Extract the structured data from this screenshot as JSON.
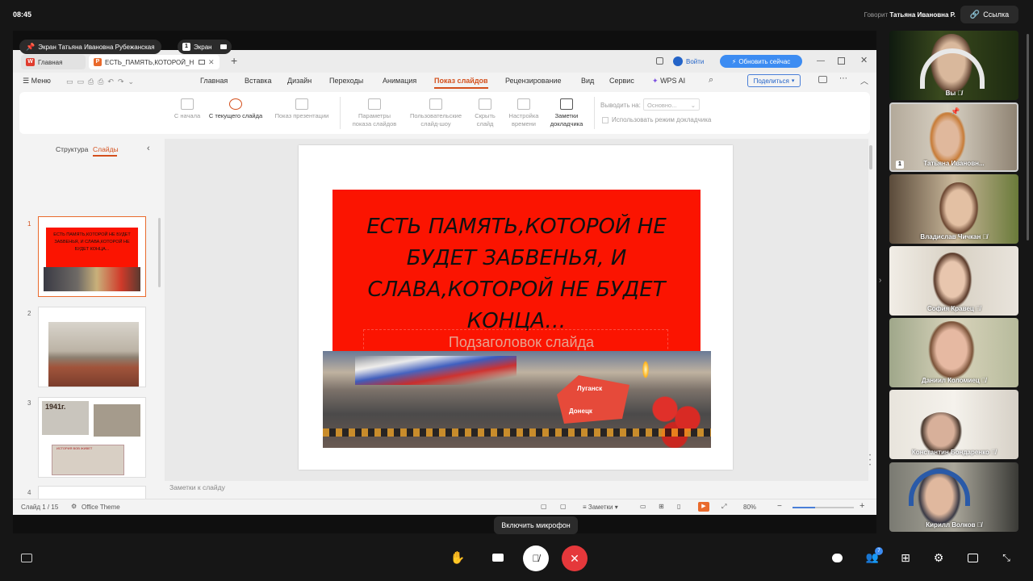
{
  "topbar": {
    "time": "08:45",
    "speaker_prefix": "Говорит",
    "speaker_name": "Татьяна Ивановна Р.",
    "link_label": "Ссылка"
  },
  "share": {
    "label": "Экран Татьяна Ивановна Рубежанская",
    "screen_pill": "Экран",
    "screen_badge": "1"
  },
  "wps": {
    "tab_home": "Главная",
    "tab_doc": "ЕСТЬ_ПАМЯТЬ,КОТОРОЙ_НЕ",
    "login": "Войти",
    "update": "Обновить сейчас",
    "menu_label": "Меню",
    "menus": [
      "Главная",
      "Вставка",
      "Дизайн",
      "Переходы",
      "Анимация",
      "Показ слайдов",
      "Рецензирование",
      "Вид",
      "Сервис",
      "WPS AI"
    ],
    "share_btn": "Поделиться",
    "ribbon": {
      "from_start": "С начала",
      "from_current": "С текущего слайда",
      "show_presentation": "Показ презентации",
      "params_1": "Параметры",
      "params_2": "показа слайдов",
      "custom_1": "Пользовательские",
      "custom_2": "слайд-шоу",
      "hide_1": "Скрыть",
      "hide_2": "слайд",
      "timing_1": "Настройка",
      "timing_2": "времени",
      "notes_1": "Заметки",
      "notes_2": "докладчика",
      "output_label": "Выводить на:",
      "output_value": "Основно...",
      "presenter_mode": "Использовать режим докладчика"
    },
    "panel": {
      "tab_structure": "Структура",
      "tab_slides": "Слайды"
    },
    "thumb_title": "ЕСТЬ ПАМЯТЬ,КОТОРОЙ НЕ БУДЕТ ЗАБВЕНЬЯ, И СЛАВА,КОТОРОЙ НЕ БУДЕТ КОНЦА...",
    "thumb_1941": "1941г.",
    "thumb_caption": "ИСТОРИЯ ВОВ ЖИВЕТ",
    "slide_numbers": [
      "1",
      "2",
      "3",
      "4"
    ],
    "slide": {
      "title": "ЕСТЬ ПАМЯТЬ,КОТОРОЙ НЕ БУДЕТ ЗАБВЕНЬЯ, И СЛАВА,КОТОРОЙ НЕ БУДЕТ КОНЦА…",
      "subtitle": "Подзаголовок слайда",
      "banner_word_1": "Луганск",
      "banner_word_2": "Донецк"
    },
    "notes_placeholder": "Заметки к слайду",
    "status": {
      "slide_counter": "Слайд 1 / 15",
      "theme": "Office Theme",
      "notes": "Заметки",
      "zoom": "80%"
    }
  },
  "participants": [
    {
      "name": "Вы"
    },
    {
      "name": "Татьяна Ивановн...",
      "badge": "1"
    },
    {
      "name": "Владислав Чичкан"
    },
    {
      "name": "София Кравец"
    },
    {
      "name": "Даниил Коломиец"
    },
    {
      "name": "Константин Бондаренко"
    },
    {
      "name": "Кирилл Волков"
    }
  ],
  "participants_count": "7",
  "controls": {
    "tooltip": "Включить микрофон"
  },
  "colors": {
    "accent_orange": "#d4501d",
    "slide_red": "#fb1401",
    "hangup_red": "#e5383b",
    "update_blue": "#3c8cf2"
  }
}
